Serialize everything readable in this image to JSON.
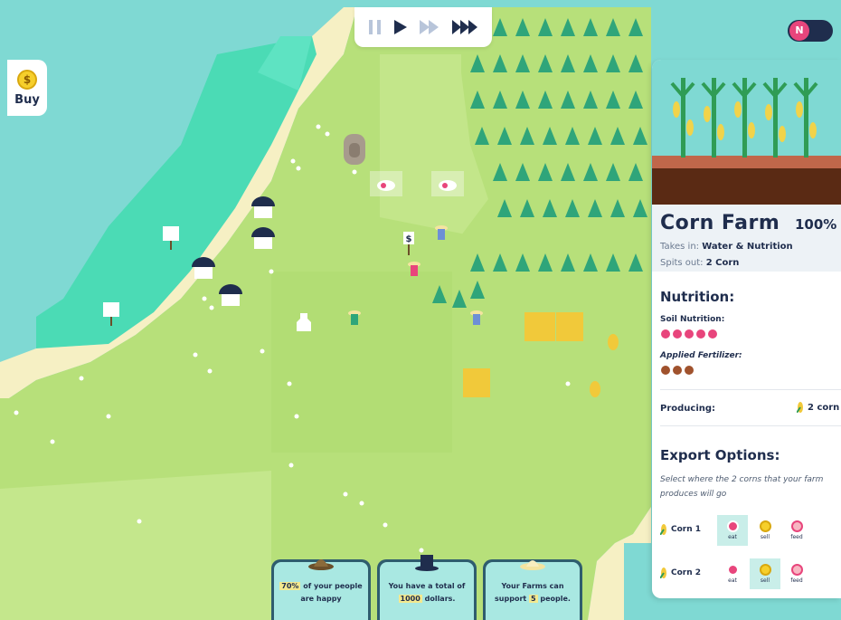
{
  "controls": {
    "pause": "pause-icon",
    "play": "play-icon",
    "fast": "fast-forward-icon",
    "fastest": "fastest-forward-icon"
  },
  "mode_toggle": {
    "label": "N"
  },
  "buy": {
    "label": "Buy",
    "icon": "dollar-coin-icon",
    "coin_symbol": "$"
  },
  "sign_symbol": "$",
  "panel": {
    "title": "Corn Farm",
    "percent": "100%",
    "takes_in_label": "Takes in:",
    "takes_in_value": "Water & Nutrition",
    "spits_out_label": "Spits out:",
    "spits_out_value": "2 Corn",
    "nutrition_heading": "Nutrition:",
    "soil_label": "Soil Nutrition:",
    "soil_level": 5,
    "fert_label": "Applied Fertilizer:",
    "fert_level": 3,
    "producing_label": "Producing:",
    "producing_value": "2 corn",
    "export_heading": "Export Options:",
    "export_desc": "Select where the 2 corns that your farm produces will go",
    "export_rows": [
      {
        "label": "Corn 1",
        "selected": "eat"
      },
      {
        "label": "Corn 2",
        "selected": "sell"
      }
    ],
    "export_options": [
      {
        "key": "eat",
        "caption": "eat",
        "icon": "eat-icon"
      },
      {
        "key": "sell",
        "caption": "sell",
        "icon": "sell-coin-icon"
      },
      {
        "key": "feed",
        "caption": "feed",
        "icon": "feed-pig-icon"
      }
    ]
  },
  "badges": [
    {
      "icon": "ranger-hat-icon",
      "pre": "",
      "value": "70%",
      "post": " of your people are happy"
    },
    {
      "icon": "top-hat-icon",
      "pre": "You have a total of ",
      "value": "1000",
      "post": " dollars."
    },
    {
      "icon": "sun-hat-icon",
      "pre": "Your Farms can support ",
      "value": "5",
      "post": " people."
    }
  ],
  "colors": {
    "water": "#7fd9d3",
    "shallow": "#4bd8b3",
    "sand": "#f6f0c4",
    "grass": "#b9e37b",
    "forest": "#2fa57a",
    "navy": "#1f2d4d",
    "pink": "#e8457c",
    "brown": "#a0522d"
  }
}
